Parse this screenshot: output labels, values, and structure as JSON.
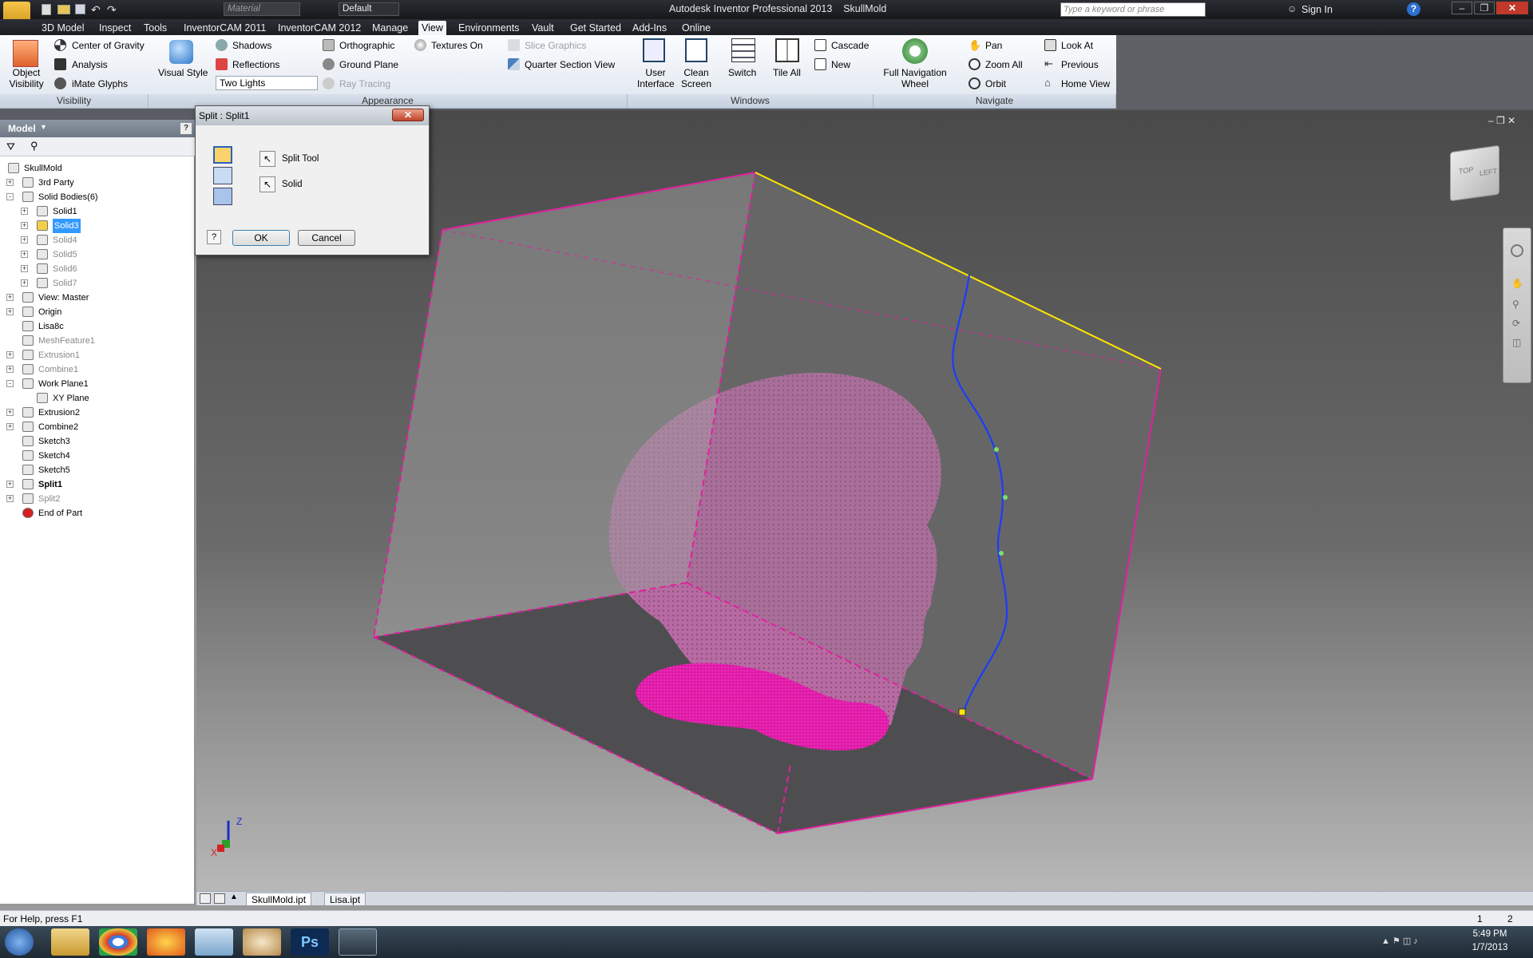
{
  "window": {
    "title": "Autodesk Inventor Professional 2013    SkullMold",
    "help_search_placeholder": "Type a keyword or phrase",
    "sign_in": "Sign In"
  },
  "quick_access": {
    "material": "Material",
    "appearance": "Default"
  },
  "menu_tabs": [
    "3D Model",
    "Inspect",
    "Tools",
    "InventorCAM 2011",
    "InventorCAM 2012",
    "Manage",
    "View",
    "Environments",
    "Vault",
    "Get Started",
    "Add-Ins",
    "Online"
  ],
  "active_tab": "View",
  "ribbon": {
    "object_visibility": "Object\nVisibility",
    "center_of_gravity": "Center of Gravity",
    "analysis": "Analysis",
    "imate_glyphs": "iMate Glyphs",
    "visual_style": "Visual Style",
    "shadows": "Shadows",
    "reflections": "Reflections",
    "lighting": "Two Lights",
    "orthographic": "Orthographic",
    "ground_plane": "Ground Plane",
    "ray_tracing": "Ray Tracing",
    "textures_on": "Textures On",
    "slice_graphics": "Slice Graphics",
    "quarter_section": "Quarter Section View",
    "user_interface": "User\nInterface",
    "clean_screen": "Clean\nScreen",
    "switch": "Switch",
    "tile_all": "Tile All",
    "cascade": "Cascade",
    "new": "New",
    "full_nav_wheel": "Full Navigation\nWheel",
    "pan": "Pan",
    "zoom_all": "Zoom All",
    "orbit": "Orbit",
    "look_at": "Look At",
    "previous": "Previous",
    "home_view": "Home View",
    "groups": {
      "visibility": "Visibility",
      "appearance": "Appearance",
      "windows": "Windows",
      "navigate": "Navigate"
    }
  },
  "browser": {
    "title": "Model",
    "tree": [
      {
        "label": "SkullMold",
        "level": 0,
        "expander": "",
        "style": "normal"
      },
      {
        "label": "3rd Party",
        "level": 1,
        "expander": "+",
        "style": "normal"
      },
      {
        "label": "Solid Bodies(6)",
        "level": 1,
        "expander": "-",
        "style": "normal"
      },
      {
        "label": "Solid1",
        "level": 2,
        "expander": "+",
        "style": "normal"
      },
      {
        "label": "Solid3",
        "level": 2,
        "expander": "+",
        "style": "selected"
      },
      {
        "label": "Solid4",
        "level": 2,
        "expander": "+",
        "style": "gray"
      },
      {
        "label": "Solid5",
        "level": 2,
        "expander": "+",
        "style": "gray"
      },
      {
        "label": "Solid6",
        "level": 2,
        "expander": "+",
        "style": "gray"
      },
      {
        "label": "Solid7",
        "level": 2,
        "expander": "+",
        "style": "gray"
      },
      {
        "label": "View: Master",
        "level": 1,
        "expander": "+",
        "style": "normal"
      },
      {
        "label": "Origin",
        "level": 1,
        "expander": "+",
        "style": "normal"
      },
      {
        "label": "Lisa8c",
        "level": 1,
        "expander": "",
        "style": "normal"
      },
      {
        "label": "MeshFeature1",
        "level": 1,
        "expander": "",
        "style": "gray"
      },
      {
        "label": "Extrusion1",
        "level": 1,
        "expander": "+",
        "style": "gray"
      },
      {
        "label": "Combine1",
        "level": 1,
        "expander": "+",
        "style": "gray"
      },
      {
        "label": "Work Plane1",
        "level": 1,
        "expander": "-",
        "style": "normal"
      },
      {
        "label": "XY Plane",
        "level": 2,
        "expander": "",
        "style": "normal"
      },
      {
        "label": "Extrusion2",
        "level": 1,
        "expander": "+",
        "style": "normal"
      },
      {
        "label": "Combine2",
        "level": 1,
        "expander": "+",
        "style": "normal"
      },
      {
        "label": "Sketch3",
        "level": 1,
        "expander": "",
        "style": "normal"
      },
      {
        "label": "Sketch4",
        "level": 1,
        "expander": "",
        "style": "normal"
      },
      {
        "label": "Sketch5",
        "level": 1,
        "expander": "",
        "style": "normal"
      },
      {
        "label": "Split1",
        "level": 1,
        "expander": "+",
        "style": "bold"
      },
      {
        "label": "Split2",
        "level": 1,
        "expander": "+",
        "style": "gray"
      },
      {
        "label": "End of Part",
        "level": 1,
        "expander": "",
        "style": "normal"
      }
    ]
  },
  "dialog": {
    "title": "Split : Split1",
    "split_tool": "Split Tool",
    "solid": "Solid",
    "ok": "OK",
    "cancel": "Cancel"
  },
  "viewcube": {
    "face_top": "TOP",
    "face_left": "LEFT"
  },
  "triad": {
    "x": "X",
    "z": "Z"
  },
  "doc_tabs": [
    "SkullMold.ipt",
    "Lisa.ipt"
  ],
  "status": {
    "help": "For Help, press F1",
    "count1": "1",
    "count2": "2"
  },
  "taskbar": {
    "time": "5:49 PM",
    "date": "1/7/2013"
  },
  "colors": {
    "edge_magenta": "#e0219e",
    "edge_yellow": "#ffe600",
    "spline_blue": "#1a3cff",
    "head_pink": "#c77bb4",
    "ribbon_accent": "#0a5bc4"
  }
}
